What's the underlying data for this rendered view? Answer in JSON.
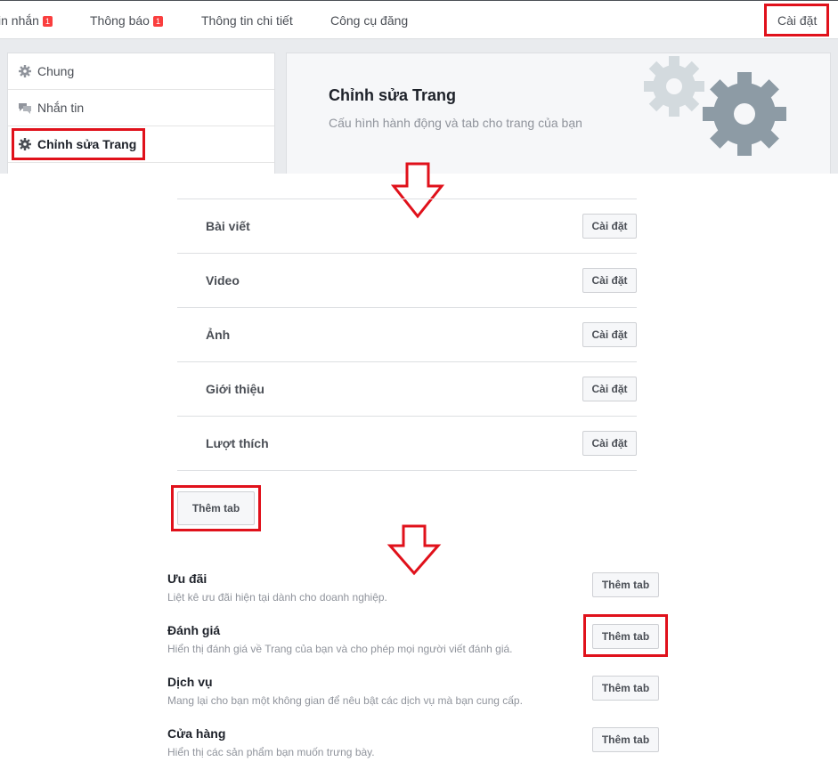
{
  "topnav": {
    "items": [
      {
        "label": "in nhắn",
        "badge": "1"
      },
      {
        "label": "Thông báo",
        "badge": "1"
      },
      {
        "label": "Thông tin chi tiết"
      },
      {
        "label": "Công cụ đăng"
      }
    ],
    "settings_label": "Cài đặt"
  },
  "sidebar": {
    "items": [
      {
        "label": "Chung",
        "icon": "gear-icon"
      },
      {
        "label": "Nhắn tin",
        "icon": "chat-bubbles-icon"
      },
      {
        "label": "Chỉnh sửa Trang",
        "icon": "gear-icon",
        "active": true
      }
    ]
  },
  "hero": {
    "title": "Chỉnh sửa Trang",
    "subtitle": "Cấu hình hành động và tab cho trang của bạn",
    "icon": "gears-icon"
  },
  "tabs": {
    "rows": [
      {
        "name": "Bài viết",
        "button": "Cài đặt"
      },
      {
        "name": "Video",
        "button": "Cài đặt"
      },
      {
        "name": "Ảnh",
        "button": "Cài đặt"
      },
      {
        "name": "Giới thiệu",
        "button": "Cài đặt"
      },
      {
        "name": "Lượt thích",
        "button": "Cài đặt"
      }
    ],
    "add_tab_label": "Thêm tab"
  },
  "add_options": [
    {
      "title": "Ưu đãi",
      "desc": "Liệt kê ưu đãi hiện tại dành cho doanh nghiệp.",
      "button": "Thêm tab"
    },
    {
      "title": "Đánh giá",
      "desc": "Hiển thị đánh giá về Trang của bạn và cho phép mọi người viết đánh giá.",
      "button": "Thêm tab"
    },
    {
      "title": "Dịch vụ",
      "desc": "Mang lại cho bạn một không gian để nêu bật các dịch vụ mà bạn cung cấp.",
      "button": "Thêm tab"
    },
    {
      "title": "Cửa hàng",
      "desc": "Hiển thị các sản phẩm bạn muốn trưng bày.",
      "button": "Thêm tab"
    }
  ],
  "colors": {
    "highlight": "#e0111b",
    "badge": "#fa3e3e",
    "gear_light": "#d3dade",
    "gear_dark": "#8d9ba5"
  }
}
